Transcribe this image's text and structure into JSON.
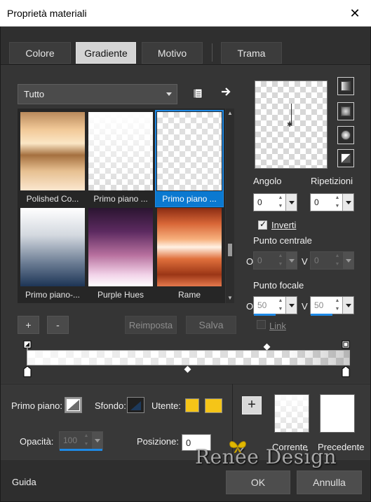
{
  "window": {
    "title": "Proprietà materiali",
    "close_glyph": "✕"
  },
  "tabs": [
    {
      "label": "Colore",
      "active": false
    },
    {
      "label": "Gradiente",
      "active": true
    },
    {
      "label": "Motivo",
      "active": false
    },
    {
      "label": "Trama",
      "active": false
    }
  ],
  "gallery": {
    "filter_value": "Tutto",
    "items": [
      {
        "label": "Polished Co...",
        "fill": "linear-gradient(180deg,#b98a5c 0%,#f1c897 22%,#fbe6c5 40%,#a5703f 55%,#e6bf90 75%,#fbe7cf 100%)",
        "checker": false,
        "selected": false
      },
      {
        "label": "Primo piano ...",
        "fill": "linear-gradient(180deg,rgba(255,255,255,1) 0%,rgba(255,255,255,0.1) 100%)",
        "checker": true,
        "selected": false
      },
      {
        "label": "Primo piano ...",
        "fill": "linear-gradient(180deg,rgba(255,255,255,0.2) 0%,rgba(255,255,255,0.2) 100%)",
        "checker": true,
        "selected": true
      },
      {
        "label": "Primo piano-...",
        "fill": "linear-gradient(180deg,#ffffff 0%,#d3d8df 35%,#6c7d94 70%,#1d3556 100%)",
        "checker": false,
        "selected": false
      },
      {
        "label": "Purple Hues",
        "fill": "linear-gradient(180deg,#2b1531 0%,#5c2a60 30%,#b7709e 60%,#f2d2e8 85%,#fff 100%)",
        "checker": false,
        "selected": false
      },
      {
        "label": "Rame",
        "fill": "linear-gradient(180deg,#8a2c12 0%,#d86637 20%,#f7b07d 40%,#fff1e4 50%,#e0703c 65%,#9b3616 85%,#e5794d 100%)",
        "checker": false,
        "selected": false
      }
    ]
  },
  "buttons": {
    "add": "+",
    "remove": "-",
    "reset": "Reimposta",
    "save": "Salva"
  },
  "angle": {
    "label": "Angolo",
    "value": "0"
  },
  "repeats": {
    "label": "Ripetizioni",
    "value": "0"
  },
  "invert": {
    "label": "Inverti",
    "checked": true
  },
  "center_point": {
    "label": "Punto centrale",
    "o_label": "O",
    "o_value": "0",
    "v_label": "V",
    "v_value": "0"
  },
  "focal_point": {
    "label": "Punto focale",
    "o_label": "O",
    "o_value": "50",
    "v_label": "V",
    "v_value": "50"
  },
  "link": {
    "label": "Link",
    "checked": false
  },
  "materials": {
    "foreground_label": "Primo piano:",
    "background_label": "Sfondo:",
    "user_label": "Utente:",
    "user_color": "#f5c518",
    "opacity_label": "Opacità:",
    "opacity_value": "100",
    "position_label": "Posizione:",
    "position_value": "0"
  },
  "comparison": {
    "current_label": "Corrente",
    "previous_label": "Precedente"
  },
  "footer": {
    "help": "Guida",
    "ok": "OK",
    "cancel": "Annulla"
  },
  "watermark": "Renée Design"
}
